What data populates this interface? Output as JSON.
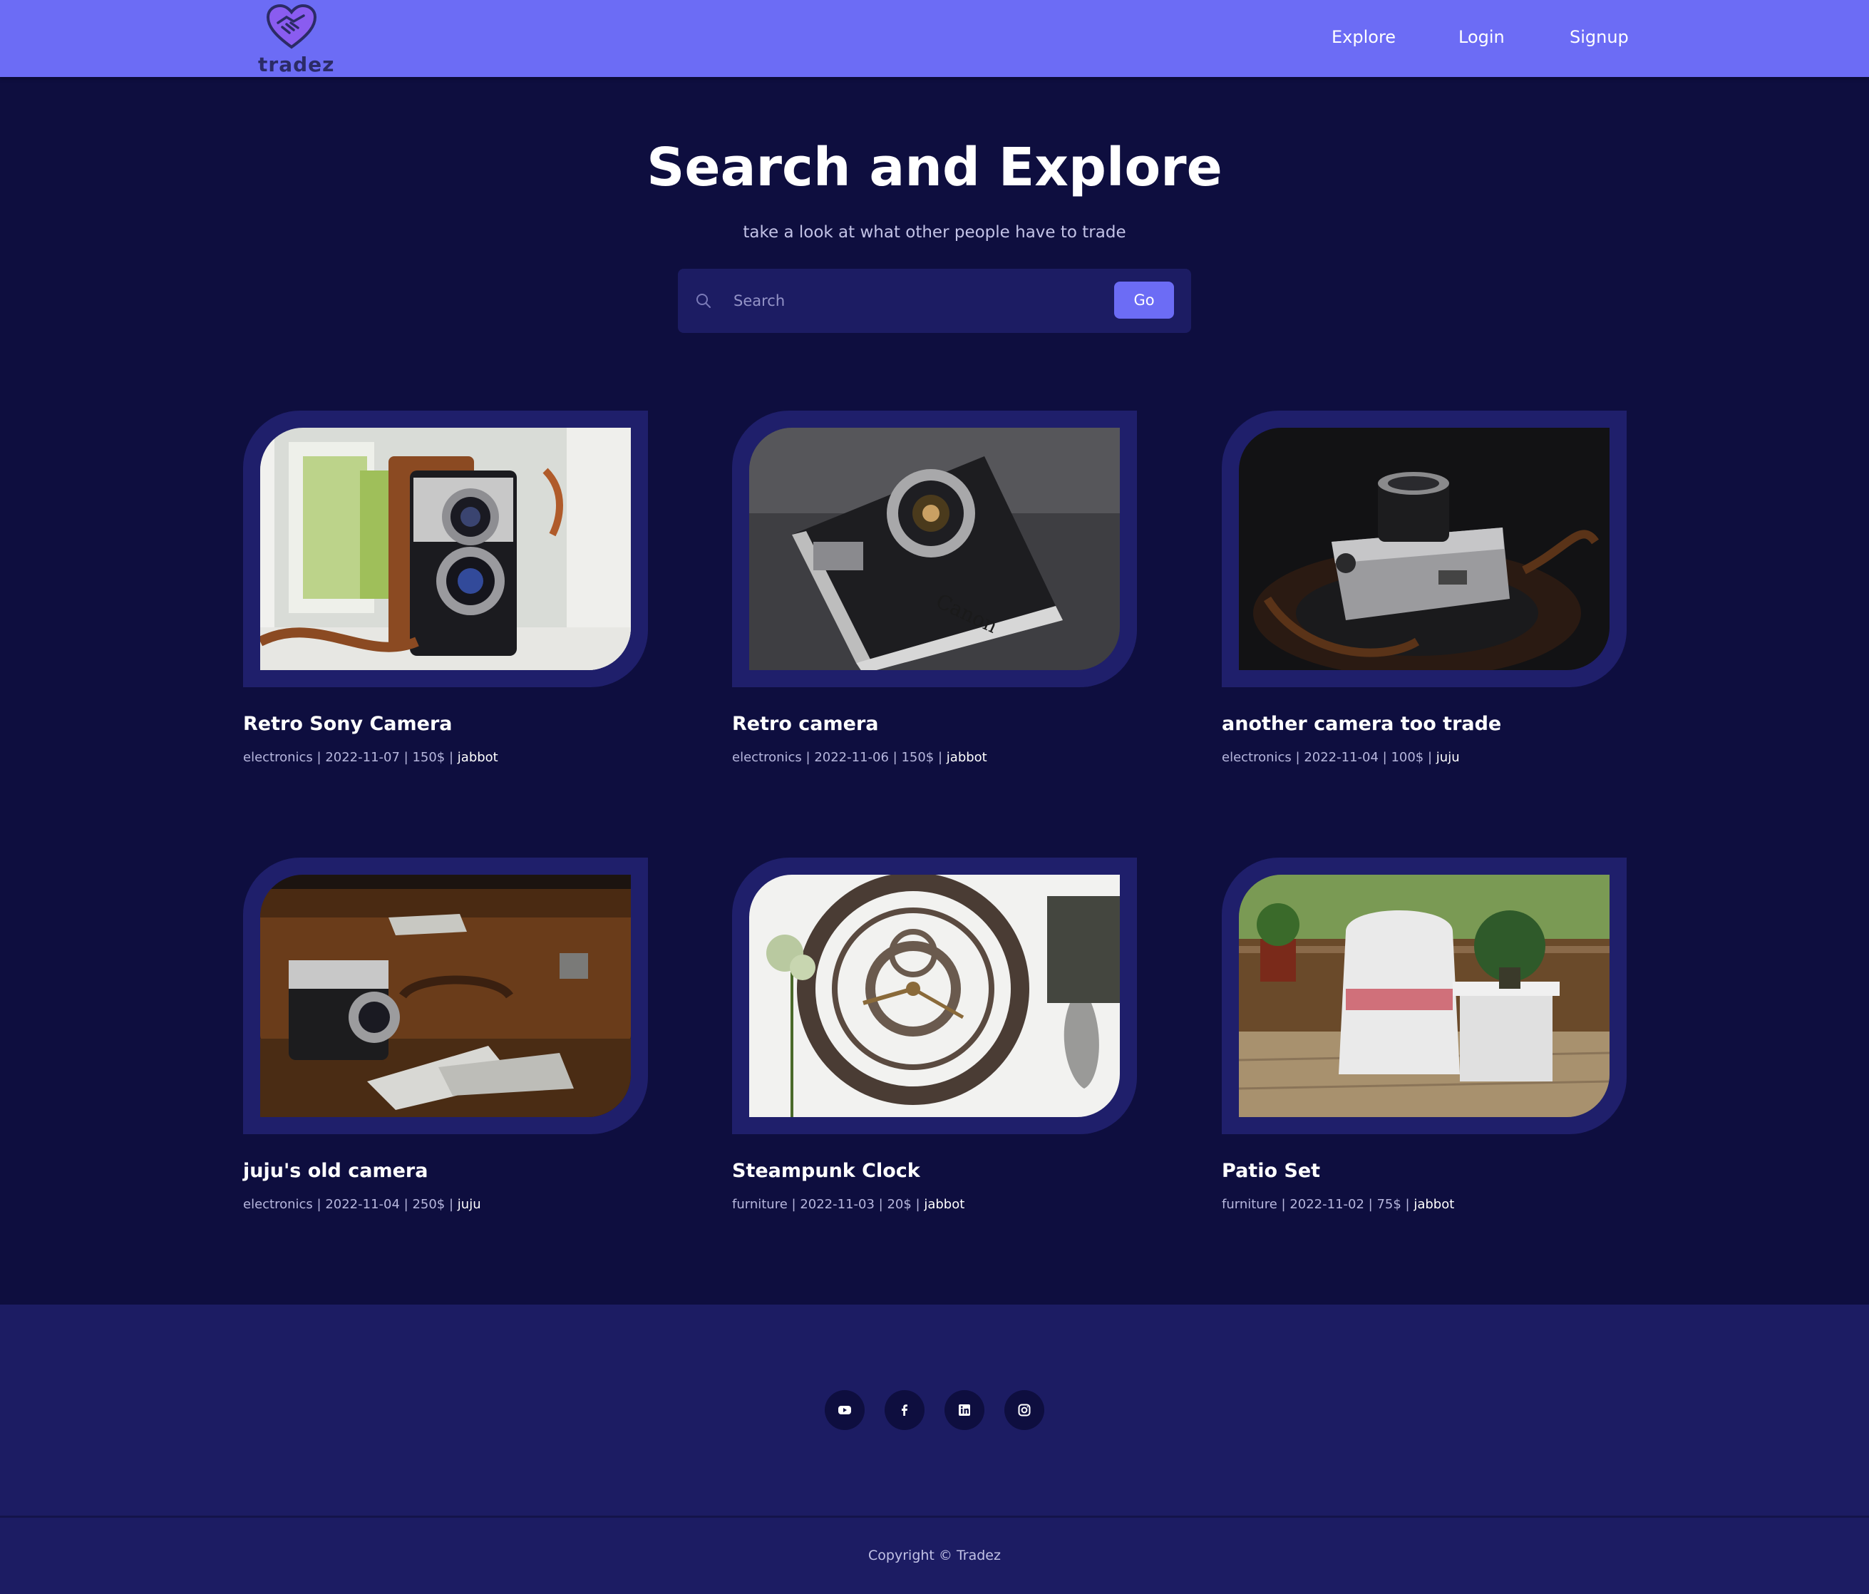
{
  "brand": {
    "name": "tradez",
    "logo_icon": "heart-handshake-icon"
  },
  "nav": {
    "explore": "Explore",
    "login": "Login",
    "signup": "Signup"
  },
  "hero": {
    "title": "Search and Explore",
    "subtitle": "take a look at what other people have to trade"
  },
  "search": {
    "placeholder": "Search",
    "value": "",
    "button": "Go",
    "icon": "search-icon"
  },
  "listings": [
    {
      "title": "Retro Sony Camera",
      "category": "electronics",
      "date": "2022-11-07",
      "price": "150$",
      "user": "jabbot",
      "image": "twin-lens-camera-photo"
    },
    {
      "title": "Retro camera",
      "category": "electronics",
      "date": "2022-11-06",
      "price": "150$",
      "user": "jabbot",
      "image": "canon-rangefinder-photo"
    },
    {
      "title": "another camera too trade",
      "category": "electronics",
      "date": "2022-11-04",
      "price": "100$",
      "user": "juju",
      "image": "compact-camera-photo"
    },
    {
      "title": "juju's old camera",
      "category": "electronics",
      "date": "2022-11-04",
      "price": "250$",
      "user": "juju",
      "image": "old-camera-suitcase-photo"
    },
    {
      "title": "Steampunk Clock",
      "category": "furniture",
      "date": "2022-11-03",
      "price": "20$",
      "user": "jabbot",
      "image": "wall-clock-photo"
    },
    {
      "title": "Patio Set",
      "category": "furniture",
      "date": "2022-11-02",
      "price": "75$",
      "user": "jabbot",
      "image": "wicker-patio-photo"
    }
  ],
  "footer": {
    "social": [
      "youtube-icon",
      "facebook-icon",
      "linkedin-icon",
      "instagram-icon"
    ],
    "copyright": "Copyright © Tradez"
  },
  "colors": {
    "header": "#6c6cf5",
    "background": "#0e0e3f",
    "card_frame": "#1f1f6b",
    "footer": "#1c1c63",
    "accent": "#6c6cf5"
  }
}
